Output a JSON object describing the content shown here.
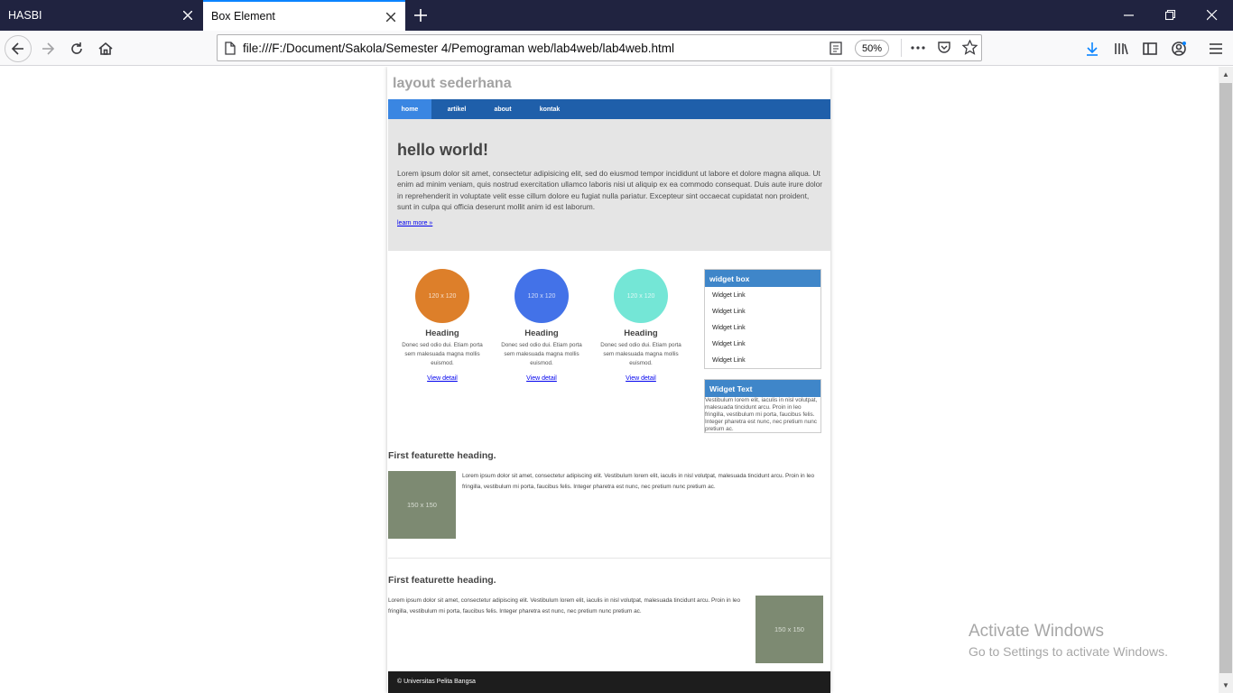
{
  "browser": {
    "tabs": [
      {
        "title": "HASBI",
        "active": false
      },
      {
        "title": "Box Element",
        "active": true
      }
    ],
    "url": "file:///F:/Document/Sakola/Semester 4/Pemograman web/lab4web/lab4web.html",
    "zoom": "50%",
    "accent_color": "#0a84ff",
    "tabbar_color": "#202340"
  },
  "page": {
    "site_title": "layout sederhana",
    "menu": [
      "home",
      "artikel",
      "about",
      "kontak"
    ],
    "menu_active": "home",
    "menu_color": "#1f5faa",
    "hero": {
      "title": "hello world!",
      "body": "Lorem ipsum dolor sit amet, consectetur adipisicing elit, sed do eiusmod tempor incididunt ut labore et dolore magna aliqua. Ut enim ad minim veniam, quis nostrud exercitation ullamco laboris nisi ut aliquip ex ea commodo consequat. Duis aute irure dolor in reprehenderit in voluptate velit esse cillum dolore eu fugiat nulla pariatur. Excepteur sint occaecat cupidatat non proident, sunt in culpa qui officia deserunt mollit anim id est laborum.",
      "link": "learn more »"
    },
    "columns": [
      {
        "placeholder": "120 x 120",
        "color": "#dd7f2a",
        "heading": "Heading",
        "text": "Donec sed odio dui. Etiam porta sem malesuada magna mollis euismod.",
        "link": "View detail"
      },
      {
        "placeholder": "120 x 120",
        "color": "#4372e8",
        "heading": "Heading",
        "text": "Donec sed odio dui. Etiam porta sem malesuada magna mollis euismod.",
        "link": "View detail"
      },
      {
        "placeholder": "120 x 120",
        "color": "#74e6d6",
        "heading": "Heading",
        "text": "Donec sed odio dui. Etiam porta sem malesuada magna mollis euismod.",
        "link": "View detail"
      }
    ],
    "widget_box": {
      "title": "widget box",
      "links": [
        "Widget Link",
        "Widget Link",
        "Widget Link",
        "Widget Link",
        "Widget Link"
      ]
    },
    "widget_text": {
      "title": "Widget Text",
      "body": "Vestibulum lorem elit, iaculis in nisl volutpat, malesuada tincidunt arcu. Proin in leo fringilla, vestibulum mi porta, faucibus felis. Integer pharetra est nunc, nec pretium nunc pretium ac."
    },
    "featurettes": [
      {
        "heading": "First featurette heading.",
        "image_label": "150 x 150",
        "text": "Lorem ipsum dolor sit amet, consectetur adipiscing elit. Vestibulum lorem elit, iaculis in nisl volutpat, malesuada tincidunt arcu. Proin in leo fringilla, vestibulum mi porta, faucibus felis. Integer pharetra est nunc, nec pretium nunc pretium ac."
      },
      {
        "heading": "First featurette heading.",
        "image_label": "150 x 150",
        "text": "Lorem ipsum dolor sit amet, consectetur adipiscing elit. Vestibulum lorem elit, iaculis in nisl volutpat, malesuada tincidunt arcu. Proin in leo fringilla, vestibulum mi porta, faucibus felis. Integer pharetra est nunc, nec pretium nunc pretium ac."
      }
    ],
    "footer": "© Universitas Pelita Bangsa"
  },
  "watermark": {
    "title": "Activate Windows",
    "subtitle": "Go to Settings to activate Windows."
  }
}
